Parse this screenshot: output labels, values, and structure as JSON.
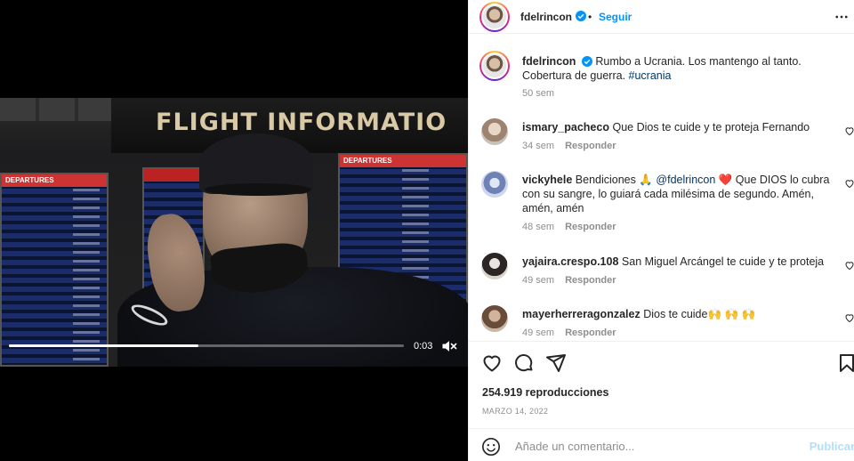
{
  "video": {
    "sign_text": "FLIGHT INFORMATIO",
    "board_label": "DEPARTURES",
    "time": "0:03",
    "progress_fraction": 0.48
  },
  "post": {
    "username": "fdelrincon",
    "follow_label": "Seguir",
    "dot": "•",
    "caption": {
      "username": "fdelrincon",
      "text": "Rumbo a Ucrania. Los mantengo al tanto. Cobertura de guerra.",
      "hashtag": "#ucrania",
      "age": "50 sem"
    },
    "comments": [
      {
        "username": "ismary_pacheco",
        "text": "Que Dios te cuide y te proteja Fernando",
        "age": "34 sem",
        "reply": "Responder"
      },
      {
        "username": "vickyhele",
        "text_before": "Bendiciones 🙏 ",
        "mention": "@fdelrincon",
        "text_after": " ❤️ Que DIOS lo cubra con su sangre, lo guiará cada milésima de segundo. Amén, amén, amén",
        "age": "48 sem",
        "reply": "Responder"
      },
      {
        "username": "yajaira.crespo.108",
        "text": "San Miguel Arcángel te cuide y te proteja",
        "age": "49 sem",
        "reply": "Responder"
      },
      {
        "username": "mayerherreragonzalez",
        "text": "Dios te cuide🙌 🙌 🙌",
        "age": "49 sem",
        "reply": "Responder"
      }
    ],
    "views": "254.919 reproducciones",
    "date": "MARZO 14, 2022",
    "comment_placeholder": "Añade un comentario...",
    "publish_label": "Publicar"
  },
  "colors": {
    "accent": "#0095f6",
    "muted": "#8e8e8e",
    "publish_disabled": "#b2dffc",
    "heart": "#ed4956"
  }
}
